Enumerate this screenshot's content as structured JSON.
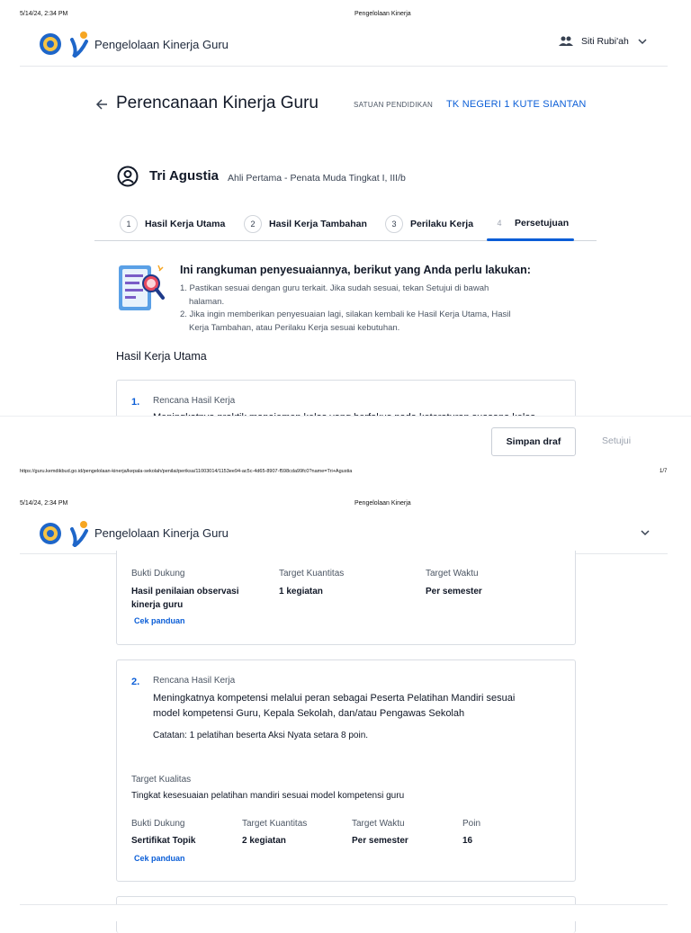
{
  "print_header": {
    "datetime": "5/14/24, 2:34 PM",
    "doc_title": "Pengelolaan Kinerja"
  },
  "print_footer": {
    "url": "https://guru.kemdikbud.go.id/pengelolaan-kinerja/kepala-sekolah/penilai/periksa/11003014/1153ee94-ac5c-4d65-8907-f598cda99fc0?name=Tri+Agustia",
    "page": "1/7"
  },
  "app": {
    "title": "Pengelolaan Kinerja Guru",
    "user_name": "Siti Rubi'ah"
  },
  "page": {
    "title": "Perencanaan Kinerja Guru",
    "unit_label": "SATUAN PENDIDIKAN",
    "unit_value": "TK NEGERI 1 KUTE SIANTAN"
  },
  "teacher": {
    "name": "Tri Agustia",
    "rank": "Ahli Pertama - Penata Muda Tingkat I, III/b"
  },
  "steps": [
    {
      "num": "1",
      "label": "Hasil Kerja Utama"
    },
    {
      "num": "2",
      "label": "Hasil Kerja Tambahan"
    },
    {
      "num": "3",
      "label": "Perilaku Kerja"
    },
    {
      "num": "4",
      "label": "Persetujuan"
    }
  ],
  "info": {
    "title": "Ini rangkuman penyesuaiannya, berikut yang Anda perlu lakukan:",
    "item1_line1": "1. Pastikan sesuai dengan guru terkait. Jika sudah sesuai, tekan Setujui di bawah",
    "item1_line2": "halaman.",
    "item2_line1": "2. Jika ingin memberikan penyesuaian lagi, silakan kembali ke Hasil Kerja Utama, Hasil",
    "item2_line2": "Kerja Tambahan, atau Perilaku Kerja sesuai kebutuhan."
  },
  "section_title": "Hasil Kerja Utama",
  "card1": {
    "index": "1.",
    "label": "Rencana Hasil Kerja",
    "text": "Meningkatnya praktik manajemen kelas yang berfokus pada keteraturan suasana kelas"
  },
  "buttons": {
    "draft": "Simpan draf",
    "approve": "Setujui"
  },
  "page2_card1": {
    "bukti_label": "Bukti Dukung",
    "bukti_line1": "Hasil penilaian observasi",
    "bukti_line2": "kinerja guru",
    "qty_label": "Target Kuantitas",
    "qty_value": "1 kegiatan",
    "time_label": "Target Waktu",
    "time_value": "Per semester",
    "guide": "Cek panduan"
  },
  "card2": {
    "index": "2.",
    "label": "Rencana Hasil Kerja",
    "text_line1": "Meningkatnya kompetensi melalui peran sebagai Peserta Pelatihan Mandiri sesuai",
    "text_line2": "model kompetensi Guru, Kepala Sekolah, dan/atau Pengawas Sekolah",
    "note": "Catatan: 1 pelatihan beserta Aksi Nyata setara 8 poin.",
    "quality_label": "Target Kualitas",
    "quality_value": "Tingkat kesesuaian pelatihan mandiri sesuai model kompetensi guru",
    "bukti_label": "Bukti Dukung",
    "bukti_value": "Sertifikat Topik",
    "qty_label": "Target Kuantitas",
    "qty_value": "2 kegiatan",
    "time_label": "Target Waktu",
    "time_value": "Per semester",
    "poin_label": "Poin",
    "poin_value": "16",
    "guide": "Cek panduan"
  }
}
